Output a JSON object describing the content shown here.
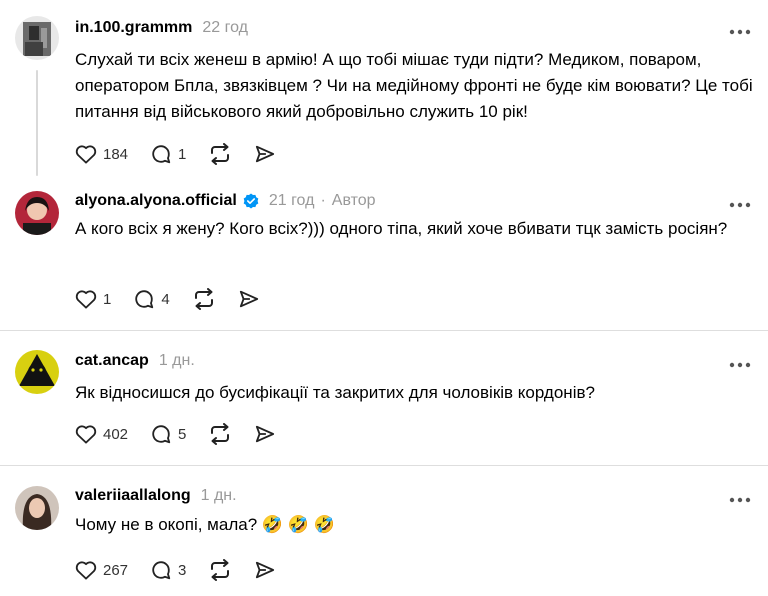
{
  "comments": [
    {
      "username": "in.100.grammm",
      "time": "22 год",
      "text": "Слухай ти всіх женеш в армію! А що тобі мішає туди підти? Медиком, поваром, оператором Бпла, звязківцем ? Чи на медійному фронті не буде кім воювати? Це тобі питання від військового який добровільно служить 10 рік!",
      "likes": "184",
      "replies": "1",
      "avatar_color": "#5a5a5a"
    },
    {
      "username": "alyona.alyona.official",
      "time": "21 год",
      "author": "Автор",
      "text": "А кого всіх я жену? Кого всіх?))) одного тіпа, який хоче вбивати тцк замість росіян?",
      "likes": "1",
      "replies": "4",
      "avatar_color": "#b3263a"
    },
    {
      "username": "cat.ancap",
      "time": "1 дн.",
      "text": "Як відносишся до бусифікації та закритих для чоловіків кордонів?",
      "likes": "402",
      "replies": "5",
      "avatar_color": "#d8d010"
    },
    {
      "username": "valeriiaallalong",
      "time": "1 дн.",
      "text": "Чому не в окопі, мала? 🤣 🤣 🤣",
      "likes": "267",
      "replies": "3",
      "avatar_color": "#3a2a22"
    }
  ],
  "colors": {
    "verified": "#0095f6",
    "muted": "#999999",
    "divider": "#dedede"
  }
}
